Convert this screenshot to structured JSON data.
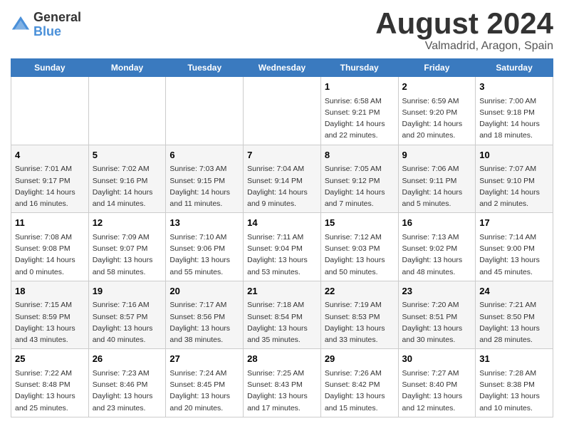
{
  "logo": {
    "general": "General",
    "blue": "Blue"
  },
  "title": "August 2024",
  "location": "Valmadrid, Aragon, Spain",
  "days_of_week": [
    "Sunday",
    "Monday",
    "Tuesday",
    "Wednesday",
    "Thursday",
    "Friday",
    "Saturday"
  ],
  "weeks": [
    [
      {
        "day": "",
        "info": ""
      },
      {
        "day": "",
        "info": ""
      },
      {
        "day": "",
        "info": ""
      },
      {
        "day": "",
        "info": ""
      },
      {
        "day": "1",
        "info": "Sunrise: 6:58 AM\nSunset: 9:21 PM\nDaylight: 14 hours\nand 22 minutes."
      },
      {
        "day": "2",
        "info": "Sunrise: 6:59 AM\nSunset: 9:20 PM\nDaylight: 14 hours\nand 20 minutes."
      },
      {
        "day": "3",
        "info": "Sunrise: 7:00 AM\nSunset: 9:18 PM\nDaylight: 14 hours\nand 18 minutes."
      }
    ],
    [
      {
        "day": "4",
        "info": "Sunrise: 7:01 AM\nSunset: 9:17 PM\nDaylight: 14 hours\nand 16 minutes."
      },
      {
        "day": "5",
        "info": "Sunrise: 7:02 AM\nSunset: 9:16 PM\nDaylight: 14 hours\nand 14 minutes."
      },
      {
        "day": "6",
        "info": "Sunrise: 7:03 AM\nSunset: 9:15 PM\nDaylight: 14 hours\nand 11 minutes."
      },
      {
        "day": "7",
        "info": "Sunrise: 7:04 AM\nSunset: 9:14 PM\nDaylight: 14 hours\nand 9 minutes."
      },
      {
        "day": "8",
        "info": "Sunrise: 7:05 AM\nSunset: 9:12 PM\nDaylight: 14 hours\nand 7 minutes."
      },
      {
        "day": "9",
        "info": "Sunrise: 7:06 AM\nSunset: 9:11 PM\nDaylight: 14 hours\nand 5 minutes."
      },
      {
        "day": "10",
        "info": "Sunrise: 7:07 AM\nSunset: 9:10 PM\nDaylight: 14 hours\nand 2 minutes."
      }
    ],
    [
      {
        "day": "11",
        "info": "Sunrise: 7:08 AM\nSunset: 9:08 PM\nDaylight: 14 hours\nand 0 minutes."
      },
      {
        "day": "12",
        "info": "Sunrise: 7:09 AM\nSunset: 9:07 PM\nDaylight: 13 hours\nand 58 minutes."
      },
      {
        "day": "13",
        "info": "Sunrise: 7:10 AM\nSunset: 9:06 PM\nDaylight: 13 hours\nand 55 minutes."
      },
      {
        "day": "14",
        "info": "Sunrise: 7:11 AM\nSunset: 9:04 PM\nDaylight: 13 hours\nand 53 minutes."
      },
      {
        "day": "15",
        "info": "Sunrise: 7:12 AM\nSunset: 9:03 PM\nDaylight: 13 hours\nand 50 minutes."
      },
      {
        "day": "16",
        "info": "Sunrise: 7:13 AM\nSunset: 9:02 PM\nDaylight: 13 hours\nand 48 minutes."
      },
      {
        "day": "17",
        "info": "Sunrise: 7:14 AM\nSunset: 9:00 PM\nDaylight: 13 hours\nand 45 minutes."
      }
    ],
    [
      {
        "day": "18",
        "info": "Sunrise: 7:15 AM\nSunset: 8:59 PM\nDaylight: 13 hours\nand 43 minutes."
      },
      {
        "day": "19",
        "info": "Sunrise: 7:16 AM\nSunset: 8:57 PM\nDaylight: 13 hours\nand 40 minutes."
      },
      {
        "day": "20",
        "info": "Sunrise: 7:17 AM\nSunset: 8:56 PM\nDaylight: 13 hours\nand 38 minutes."
      },
      {
        "day": "21",
        "info": "Sunrise: 7:18 AM\nSunset: 8:54 PM\nDaylight: 13 hours\nand 35 minutes."
      },
      {
        "day": "22",
        "info": "Sunrise: 7:19 AM\nSunset: 8:53 PM\nDaylight: 13 hours\nand 33 minutes."
      },
      {
        "day": "23",
        "info": "Sunrise: 7:20 AM\nSunset: 8:51 PM\nDaylight: 13 hours\nand 30 minutes."
      },
      {
        "day": "24",
        "info": "Sunrise: 7:21 AM\nSunset: 8:50 PM\nDaylight: 13 hours\nand 28 minutes."
      }
    ],
    [
      {
        "day": "25",
        "info": "Sunrise: 7:22 AM\nSunset: 8:48 PM\nDaylight: 13 hours\nand 25 minutes."
      },
      {
        "day": "26",
        "info": "Sunrise: 7:23 AM\nSunset: 8:46 PM\nDaylight: 13 hours\nand 23 minutes."
      },
      {
        "day": "27",
        "info": "Sunrise: 7:24 AM\nSunset: 8:45 PM\nDaylight: 13 hours\nand 20 minutes."
      },
      {
        "day": "28",
        "info": "Sunrise: 7:25 AM\nSunset: 8:43 PM\nDaylight: 13 hours\nand 17 minutes."
      },
      {
        "day": "29",
        "info": "Sunrise: 7:26 AM\nSunset: 8:42 PM\nDaylight: 13 hours\nand 15 minutes."
      },
      {
        "day": "30",
        "info": "Sunrise: 7:27 AM\nSunset: 8:40 PM\nDaylight: 13 hours\nand 12 minutes."
      },
      {
        "day": "31",
        "info": "Sunrise: 7:28 AM\nSunset: 8:38 PM\nDaylight: 13 hours\nand 10 minutes."
      }
    ]
  ]
}
